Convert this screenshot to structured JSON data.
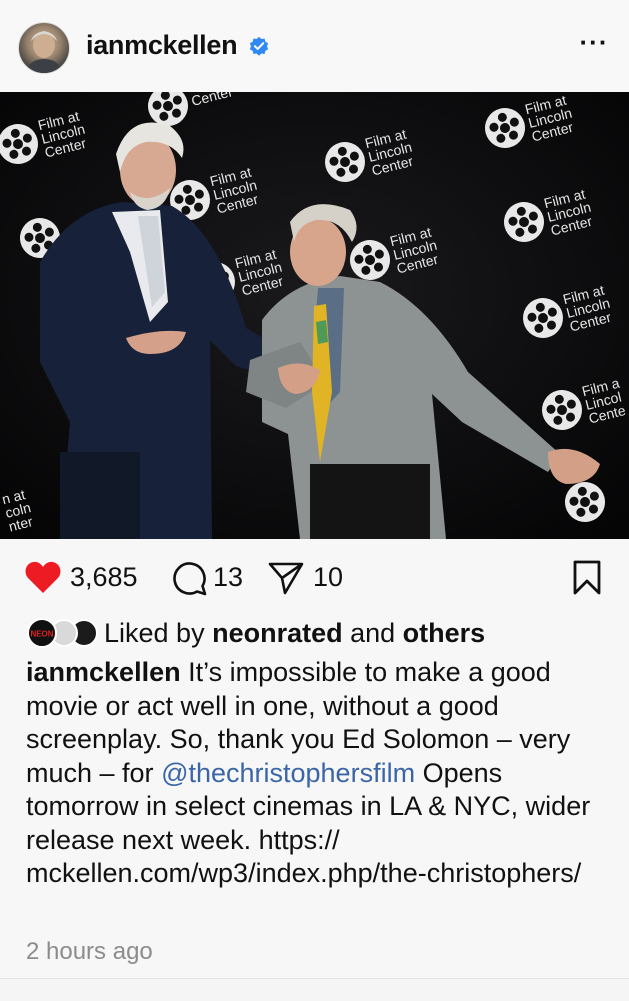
{
  "post": {
    "username": "ianmckellen",
    "verified": true,
    "more_label": "···"
  },
  "photo": {
    "backdrop_logo_text": [
      "Film at",
      "Lincoln",
      "Center"
    ]
  },
  "actions": {
    "likes": "3,685",
    "comments": "13",
    "shares": "10",
    "like_color": "#ed1c24"
  },
  "liked_by": {
    "prefix": "Liked by ",
    "user": "neonrated",
    "middle": " and ",
    "others": "others",
    "avatar_labels": [
      "NEON",
      "",
      ""
    ]
  },
  "caption": {
    "username": "ianmckellen",
    "text_before": " It’s impossible to make a good movie or act well in one, without a good screenplay. So, thank you Ed Solomon – very much – for ",
    "mention": "@thechristophersfilm",
    "text_after": " Opens tomorrow in select cinemas in LA & NYC, wider release next week. https:// mckellen.com/wp3/index.php/the-christophers/"
  },
  "timestamp": "2 hours ago",
  "icons": {
    "like": "heart-icon",
    "comment": "comment-icon",
    "share": "send-icon",
    "save": "bookmark-icon",
    "verified": "verified-badge-icon",
    "more": "more-options-icon"
  }
}
